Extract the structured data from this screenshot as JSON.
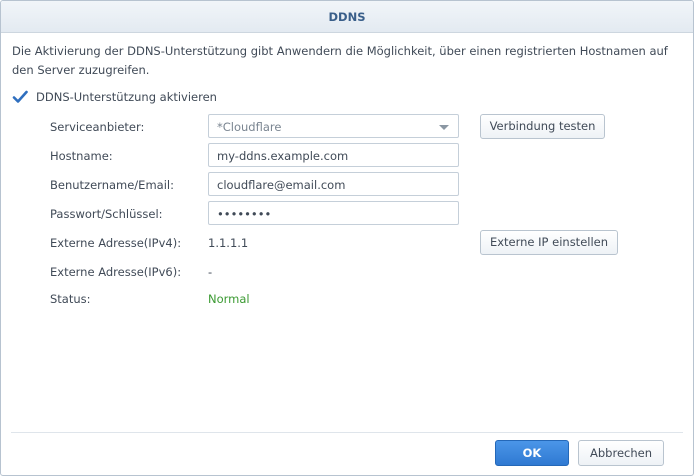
{
  "dialog": {
    "title": "DDNS",
    "description": "Die Aktivierung der DDNS-Unterstützung gibt Anwendern die Möglichkeit, über einen registrierten Hostnamen auf den Server zuzugreifen."
  },
  "enable": {
    "label": "DDNS-Unterstützung aktivieren",
    "checked": true
  },
  "form": {
    "provider": {
      "label": "Serviceanbieter:",
      "value": "*Cloudflare"
    },
    "hostname": {
      "label": "Hostname:",
      "value": "my-ddns.example.com"
    },
    "username": {
      "label": "Benutzername/Email:",
      "value": "cloudflare@email.com"
    },
    "password": {
      "label": "Passwort/Schlüssel:",
      "value": "••••••••"
    },
    "ipv4": {
      "label": "Externe Adresse(IPv4):",
      "value": "1.1.1.1"
    },
    "ipv6": {
      "label": "Externe Adresse(IPv6):",
      "value": "-"
    },
    "status": {
      "label": "Status:",
      "value": "Normal"
    }
  },
  "buttons": {
    "test_connection": "Verbindung testen",
    "set_external_ip": "Externe IP einstellen",
    "ok": "OK",
    "cancel": "Abbrechen"
  },
  "colors": {
    "accent": "#2f79d2",
    "title": "#3a5f8a",
    "status_normal": "#3b9a32",
    "checkmark": "#2f6fbf"
  },
  "icons": {
    "checkbox": "checkmark-icon",
    "dropdown": "chevron-down-icon"
  }
}
